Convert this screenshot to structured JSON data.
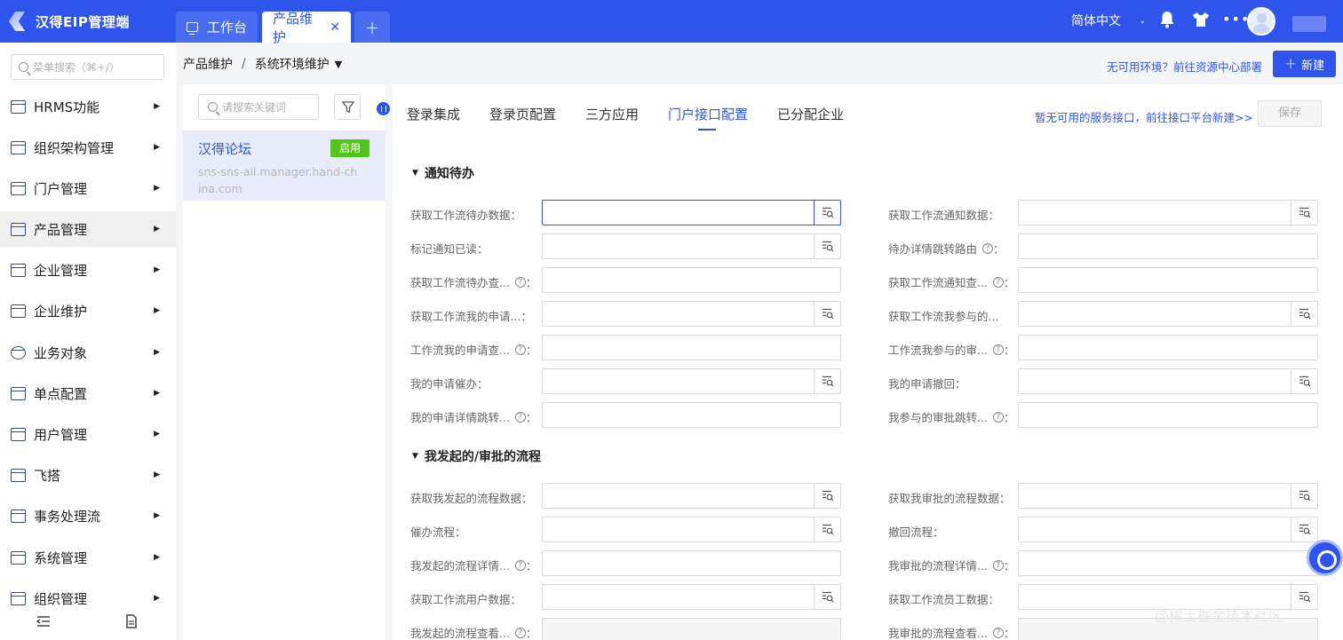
{
  "app": {
    "title": "汉得EIP管理端"
  },
  "tabs": [
    {
      "label": "工作台"
    },
    {
      "label": "产品维护"
    }
  ],
  "header": {
    "language": "简体中文"
  },
  "menu": {
    "search_placeholder": "菜单搜索（⌘+/）",
    "items": [
      {
        "label": "HRMS功能"
      },
      {
        "label": "组织架构管理"
      },
      {
        "label": "门户管理"
      },
      {
        "label": "产品管理"
      },
      {
        "label": "企业管理"
      },
      {
        "label": "企业维护"
      },
      {
        "label": "业务对象"
      },
      {
        "label": "单点配置"
      },
      {
        "label": "用户管理"
      },
      {
        "label": "飞搭"
      },
      {
        "label": "事务处理流"
      },
      {
        "label": "系统管理"
      },
      {
        "label": "组织管理"
      }
    ]
  },
  "breadcrumb": {
    "parent": "产品维护",
    "sep": "/",
    "current": "系统环境维护"
  },
  "top_actions": {
    "env_link": "无可用环境？前往资源中心部署",
    "new_label": "新建"
  },
  "list": {
    "search_placeholder": "请搜索关键词",
    "card": {
      "title": "汉得论坛",
      "status": "启用",
      "subtitle": "sns-sns-all.manager.hand-china.com"
    }
  },
  "content_tabs": [
    {
      "label": "登录集成"
    },
    {
      "label": "登录页配置"
    },
    {
      "label": "三方应用"
    },
    {
      "label": "门户接口配置"
    },
    {
      "label": "已分配企业"
    }
  ],
  "service_link": "暂无可用的服务接口，前往接口平台新建>>",
  "save_label": "保存",
  "sections": [
    {
      "title": "通知待办",
      "left": [
        {
          "label": "获取工作流待办数据：",
          "help": false,
          "lookup": true,
          "focus": true
        },
        {
          "label": "标记通知已读：",
          "help": false,
          "lookup": true
        },
        {
          "label": "获取工作流待办查...",
          "help": true,
          "lookup": false
        },
        {
          "label": "获取工作流我的申请...：",
          "help": false,
          "lookup": true
        },
        {
          "label": "工作流我的申请查...",
          "help": true,
          "lookup": false
        },
        {
          "label": "我的申请催办：",
          "help": false,
          "lookup": true
        },
        {
          "label": "我的申请详情跳转...",
          "help": true,
          "lookup": false
        }
      ],
      "right": [
        {
          "label": "获取工作流通知数据：",
          "help": false,
          "lookup": true
        },
        {
          "label": "待办详情跳转路由",
          "help": true,
          "lookup": false
        },
        {
          "label": "获取工作流通知查...",
          "help": true,
          "lookup": false
        },
        {
          "label": "获取工作流我参与的...",
          "help": false,
          "lookup": true
        },
        {
          "label": "工作流我参与的审...",
          "help": true,
          "lookup": false
        },
        {
          "label": "我的申请撤回：",
          "help": false,
          "lookup": true
        },
        {
          "label": "我参与的审批跳转...",
          "help": true,
          "lookup": false
        }
      ]
    },
    {
      "title": "我发起的/审批的流程",
      "left": [
        {
          "label": "获取我发起的流程数据：",
          "help": false,
          "lookup": true
        },
        {
          "label": "催办流程：",
          "help": false,
          "lookup": true
        },
        {
          "label": "我发起的流程详情...",
          "help": true,
          "lookup": false
        },
        {
          "label": "获取工作流用户数据：",
          "help": false,
          "lookup": true
        },
        {
          "label": "我发起的流程查看...",
          "help": true,
          "lookup": false,
          "disabled": true
        }
      ],
      "right": [
        {
          "label": "获取我审批的流程数据：",
          "help": false,
          "lookup": true
        },
        {
          "label": "撤回流程：",
          "help": false,
          "lookup": true
        },
        {
          "label": "我审批的流程详情...",
          "help": true,
          "lookup": false
        },
        {
          "label": "获取工作流员工数据：",
          "help": false,
          "lookup": true
        },
        {
          "label": "我审批的流程查看...",
          "help": true,
          "lookup": false,
          "disabled": true
        }
      ]
    }
  ],
  "watermark": "@稀土掘金技术社区",
  "colors": {
    "primary": "#2f54eb",
    "success": "#52c41a"
  }
}
